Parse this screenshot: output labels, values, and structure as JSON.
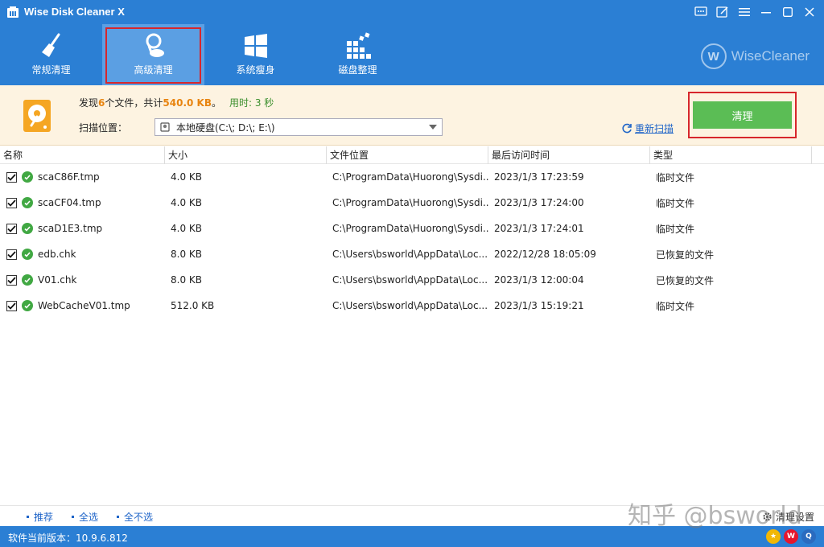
{
  "app": {
    "title": "Wise Disk Cleaner X",
    "brand": "WiseCleaner",
    "brand_letter": "W"
  },
  "nav": {
    "items": [
      {
        "label": "常规清理",
        "icon": "broom-icon"
      },
      {
        "label": "高级清理",
        "icon": "vacuum-icon",
        "active": true
      },
      {
        "label": "系统瘦身",
        "icon": "windows-icon"
      },
      {
        "label": "磁盘整理",
        "icon": "defrag-icon"
      }
    ]
  },
  "summary": {
    "found_prefix": "发现",
    "file_count": "6",
    "files_text": "个文件，共计",
    "total_size": "540.0 KB",
    "period": "。",
    "time_used": "用时: 3 秒",
    "scan_location_label": "扫描位置：",
    "scan_location_value": "本地硬盘(C:\\; D:\\; E:\\)",
    "rescan_label": "重新扫描",
    "clean_label": "清理"
  },
  "table": {
    "headers": [
      "名称",
      "大小",
      "文件位置",
      "最后访问时间",
      "类型"
    ],
    "rows": [
      {
        "name": "scaC86F.tmp",
        "size": "4.0 KB",
        "location": "C:\\ProgramData\\Huorong\\Sysdi...",
        "accessed": "2023/1/3 17:23:59",
        "type": "临时文件"
      },
      {
        "name": "scaCF04.tmp",
        "size": "4.0 KB",
        "location": "C:\\ProgramData\\Huorong\\Sysdi...",
        "accessed": "2023/1/3 17:24:00",
        "type": "临时文件"
      },
      {
        "name": "scaD1E3.tmp",
        "size": "4.0 KB",
        "location": "C:\\ProgramData\\Huorong\\Sysdi...",
        "accessed": "2023/1/3 17:24:01",
        "type": "临时文件"
      },
      {
        "name": "edb.chk",
        "size": "8.0 KB",
        "location": "C:\\Users\\bsworld\\AppData\\Loc...",
        "accessed": "2022/12/28 18:05:09",
        "type": "已恢复的文件"
      },
      {
        "name": "V01.chk",
        "size": "8.0 KB",
        "location": "C:\\Users\\bsworld\\AppData\\Loc...",
        "accessed": "2023/1/3 12:00:04",
        "type": "已恢复的文件"
      },
      {
        "name": "WebCacheV01.tmp",
        "size": "512.0 KB",
        "location": "C:\\Users\\bsworld\\AppData\\Loc...",
        "accessed": "2023/1/3 15:19:21",
        "type": "临时文件"
      }
    ]
  },
  "footer": {
    "recommend": "推荐",
    "select_all": "全选",
    "select_none": "全不选",
    "settings": "清理设置"
  },
  "status": {
    "version": "软件当前版本：10.9.6.812"
  },
  "watermark": "知乎 @bsworld",
  "colors": {
    "primary_blue": "#2b7fd4",
    "active_tab": "#5b9fe3",
    "clean_green": "#5bbd55",
    "highlight_orange": "#e8840f",
    "summary_bg": "#fdf3e1",
    "annotation_red": "#d7262c"
  }
}
